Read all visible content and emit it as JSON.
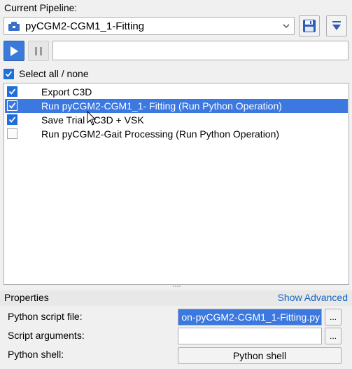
{
  "header": {
    "current_pipeline_label": "Current Pipeline:",
    "pipeline_name": "pyCGM2-CGM1_1-Fitting"
  },
  "toolbar": {
    "save_icon": "floppy-disk-icon",
    "menu_icon": "dropdown-menu-icon",
    "play_icon": "play-icon",
    "pause_icon": "pause-icon",
    "progress_fraction": 0
  },
  "select_all": {
    "label": "Select all / none",
    "checked": true
  },
  "operations": [
    {
      "label": "Export C3D",
      "checked": true,
      "selected": false
    },
    {
      "label": "Run pyCGM2-CGM1_1- Fitting  (Run Python Operation)",
      "checked": true,
      "selected": true
    },
    {
      "label": "Save Trial - C3D + VSK",
      "checked": true,
      "selected": false
    },
    {
      "label": "Run pyCGM2-Gait Processing  (Run Python Operation)",
      "checked": false,
      "selected": false
    }
  ],
  "properties": {
    "title": "Properties",
    "show_advanced": "Show Advanced",
    "script_file_label": "Python script file:",
    "script_file_value": "on-pyCGM2-CGM1_1-Fitting.py",
    "script_args_label": "Script arguments:",
    "script_args_value": "",
    "shell_label": "Python shell:",
    "shell_button": "Python shell",
    "browse_label": "..."
  },
  "colors": {
    "selection": "#3b78e0",
    "play_button": "#3c7ad9",
    "link": "#1565c0"
  }
}
